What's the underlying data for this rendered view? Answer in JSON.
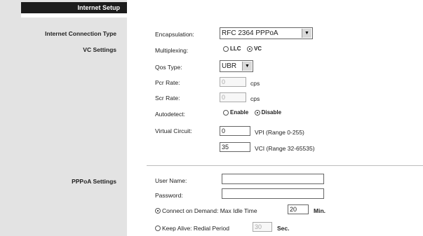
{
  "sidebar": {
    "section_title": "Internet Setup",
    "connection_type_label": "Internet Connection Type",
    "vc_settings_label": "VC Settings",
    "pppoa_settings_label": "PPPoA Settings"
  },
  "vc": {
    "encapsulation_label": "Encapsulation:",
    "encapsulation_value": "RFC 2364 PPPoA",
    "multiplexing_label": "Multiplexing:",
    "multiplexing_options": [
      "LLC",
      "VC"
    ],
    "multiplexing_selected": "VC",
    "qos_label": "Qos Type:",
    "qos_value": "UBR",
    "pcr_label": "Pcr Rate:",
    "pcr_value": "0",
    "pcr_unit": "cps",
    "scr_label": "Scr Rate:",
    "scr_value": "0",
    "scr_unit": "cps",
    "autodetect_label": "Autodetect:",
    "autodetect_options": [
      "Enable",
      "Disable"
    ],
    "autodetect_selected": "Disable",
    "virtual_circuit_label": "Virtual Circuit:",
    "vpi_value": "0",
    "vpi_range": "VPI (Range 0-255)",
    "vci_value": "35",
    "vci_range": "VCI (Range 32-65535)"
  },
  "pppoa": {
    "username_label": "User Name:",
    "username_value": "",
    "password_label": "Password:",
    "password_value": "",
    "connect_on_demand_label": "Connect on Demand: Max Idle Time",
    "max_idle_value": "20",
    "max_idle_unit": "Min.",
    "keep_alive_label": "Keep Alive: Redial Period",
    "redial_value": "30",
    "redial_unit": "Sec."
  }
}
